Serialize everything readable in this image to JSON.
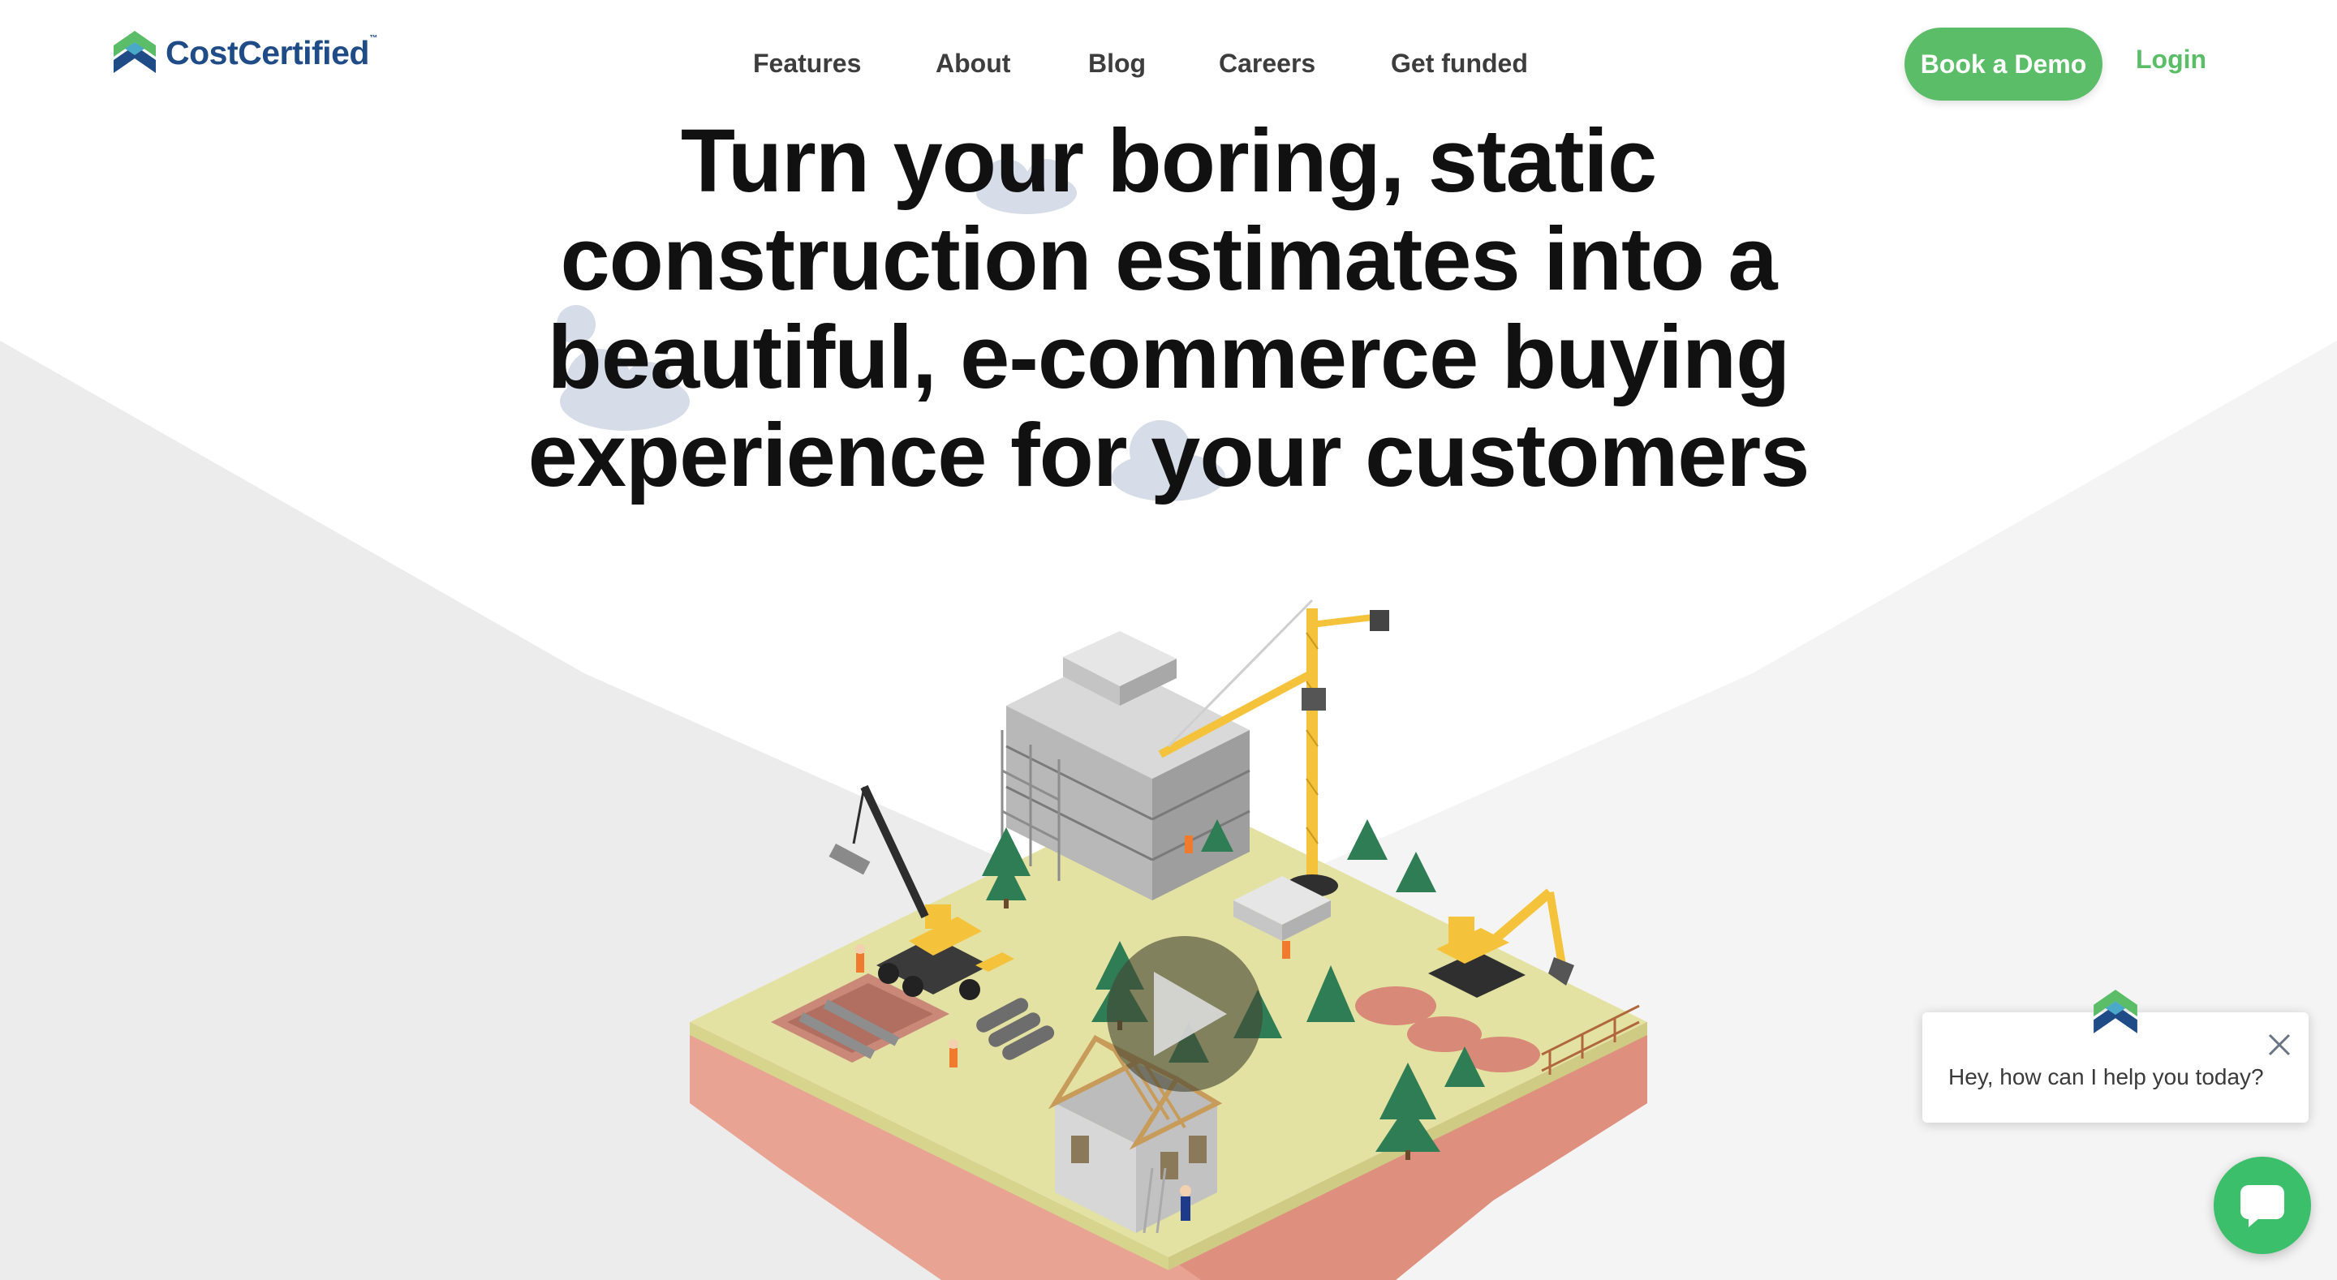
{
  "header": {
    "brand": "CostCertified",
    "brand_tm": "™",
    "nav": [
      {
        "label": "Features"
      },
      {
        "label": "About"
      },
      {
        "label": "Blog"
      },
      {
        "label": "Careers"
      },
      {
        "label": "Get funded"
      }
    ],
    "cta_label": "Book a Demo",
    "login_label": "Login"
  },
  "hero": {
    "title_lines": [
      "Turn your boring, static",
      "construction estimates into a",
      "beautiful, e-commerce buying",
      "experience for your customers"
    ]
  },
  "chat": {
    "message": "Hey, how can I help you today?"
  },
  "colors": {
    "brand_green": "#5cbd68",
    "brand_blue": "#1f4b87",
    "chat_green": "#3bbf6a",
    "ground": "#e1e0a0",
    "soil": "#e8a393"
  },
  "icons": {
    "logo": "costcertified-chevron-logo",
    "play": "play-icon",
    "close": "close-icon",
    "chat": "chat-icon"
  }
}
